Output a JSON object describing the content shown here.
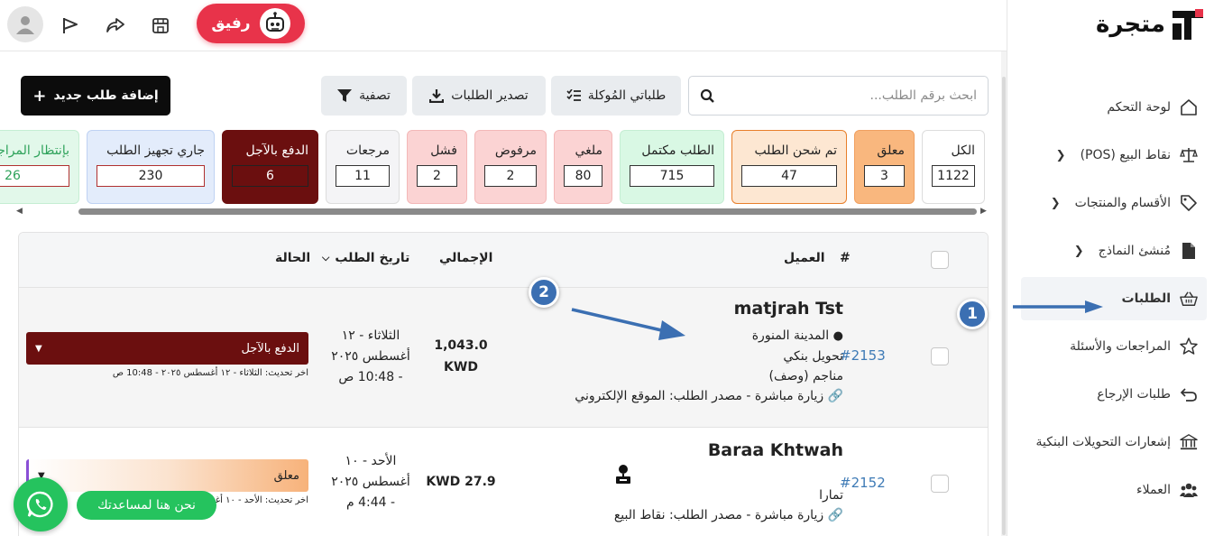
{
  "brand": {
    "name": "متجرة"
  },
  "topbar": {
    "assistant_label": "رفيق"
  },
  "sidebar": {
    "items": [
      {
        "label": "لوحة التحكم",
        "icon": "home-icon",
        "chevron": false
      },
      {
        "label": "نقاط البيع (POS)",
        "icon": "scale-icon",
        "chevron": true
      },
      {
        "label": "الأقسام والمنتجات",
        "icon": "tag-icon",
        "chevron": true
      },
      {
        "label": "مُنشئ النماذج",
        "icon": "document-icon",
        "chevron": true
      },
      {
        "label": "الطلبات",
        "icon": "basket-icon",
        "chevron": false,
        "active": true
      },
      {
        "label": "المراجعات والأسئلة",
        "icon": "star-icon",
        "chevron": false
      },
      {
        "label": "طلبات الإرجاع",
        "icon": "return-icon",
        "chevron": false
      },
      {
        "label": "إشعارات التحويلات البنكية",
        "icon": "bank-icon",
        "chevron": false
      },
      {
        "label": "العملاء",
        "icon": "users-icon",
        "chevron": false
      }
    ]
  },
  "annotations": {
    "one": "1",
    "two": "2"
  },
  "toolbar": {
    "search_placeholder": "ابحث برقم الطلب...",
    "assigned_label": "طلباتي المُوكلة",
    "export_label": "تصدير الطلبات",
    "filter_label": "تصفية",
    "add_label": "إضافة طلب جديد"
  },
  "status_cards": [
    {
      "label": "الكل",
      "count": "1122",
      "bg": "#ffffff",
      "border": "#dddddd"
    },
    {
      "label": "معلق",
      "count": "3",
      "bg": "#f9b77e",
      "border": "#f0a060"
    },
    {
      "label": "تم شحن الطلب",
      "count": "47",
      "bg": "#fde7d2",
      "border": "#e87f2b"
    },
    {
      "label": "الطلب مكتمل",
      "count": "715",
      "bg": "#d9f8e4",
      "border": "#c5eed3"
    },
    {
      "label": "ملغي",
      "count": "80",
      "bg": "#fbd3d3",
      "border": "#f3b8b8"
    },
    {
      "label": "مرفوض",
      "count": "2",
      "bg": "#fbd3d3",
      "border": "#f3b8b8"
    },
    {
      "label": "فشل",
      "count": "2",
      "bg": "#fbd3d3",
      "border": "#f3b8b8"
    },
    {
      "label": "مرجعات",
      "count": "11",
      "bg": "#f4f4f6",
      "border": "#dddddd"
    },
    {
      "label": "الدفع بالآجل",
      "count": "6",
      "bg": "#6b0f0f",
      "border": "#6b0f0f"
    },
    {
      "label": "جاري تجهيز الطلب",
      "count": "230",
      "bg": "#e3ecfb",
      "border": "#bfd2f3"
    },
    {
      "label": "بإنتظار المراجعة",
      "count": "26",
      "bg": "#e2f8ea",
      "border": "#c5eed3"
    }
  ],
  "table": {
    "headers": {
      "id": "#",
      "customer": "العميل",
      "total": "الإجمالي",
      "date": "تاريخ الطلب",
      "status": "الحالة"
    },
    "rows": [
      {
        "id": "#2153",
        "customer": "matjrah Tst",
        "city": "المدينة المنورة",
        "payment": "تحويل بنكي",
        "extra1": "مناجم (وصف)",
        "source": "زيارة مباشرة - مصدر الطلب: الموقع الإلكتروني",
        "total_amount": "1,043.0",
        "total_currency": "KWD",
        "date_line1": "الثلاثاء - ١٢",
        "date_line2": "أغسطس ٢٠٢٥",
        "date_line3": "- 10:48 ص",
        "status": "الدفع بالآجل",
        "status_color": "#6b0f0f",
        "updated": "اخر تحديث: الثلاثاء - ١٢ أغسطس ٢٠٢٥ - 10:48 ص"
      },
      {
        "id": "#2152",
        "customer": "Baraa Khtwah",
        "city": "تمارا",
        "source": "زيارة مباشرة - مصدر الطلب: نقاط البيع",
        "total": "KWD 27.9",
        "date_line1": "الأحد - ١٠",
        "date_line2": "أغسطس ٢٠٢٥",
        "date_line3": "- 4:44 م",
        "status": "معلق",
        "status_color": "#f9b77e",
        "updated": "اخر تحديث: الأحد - ١٠ أغسطس ٢٠٢٥ - 4:44 م"
      }
    ]
  },
  "chat": {
    "help_label": "نحن هنا لمساعدتك"
  }
}
